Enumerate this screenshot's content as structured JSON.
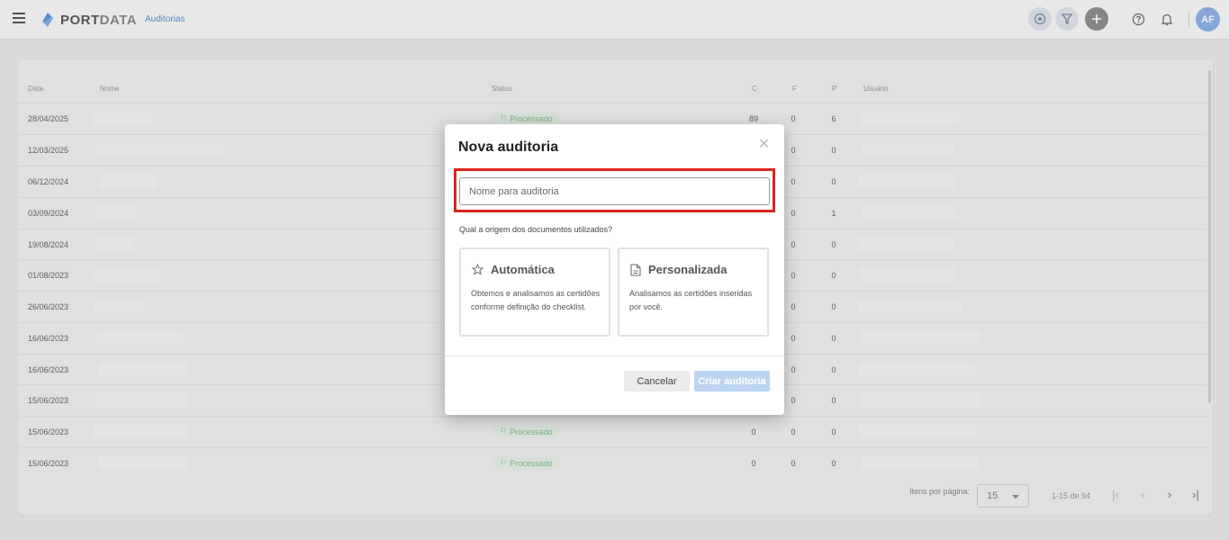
{
  "header": {
    "logo_part1": "PORT",
    "logo_part2": "DATA",
    "breadcrumb": "Auditorias",
    "user_initials": "AF",
    "icons": [
      "menu-icon",
      "target-icon",
      "filter-icon",
      "plus-icon",
      "help-icon",
      "bell-icon"
    ]
  },
  "table": {
    "columns": {
      "date": "Data",
      "name": "Nome",
      "status": "Status",
      "c": "C",
      "f": "F",
      "p": "P",
      "user": "Usuário"
    },
    "rows": [
      {
        "date": "28/04/2025",
        "status": "Processado",
        "c": "89",
        "f": "0",
        "p": "6"
      },
      {
        "date": "12/03/2025",
        "status": "",
        "c": "",
        "f": "0",
        "p": "0"
      },
      {
        "date": "06/12/2024",
        "status": "",
        "c": "",
        "f": "0",
        "p": "0"
      },
      {
        "date": "03/09/2024",
        "status": "",
        "c": "",
        "f": "0",
        "p": "1"
      },
      {
        "date": "19/08/2024",
        "status": "",
        "c": "",
        "f": "0",
        "p": "0"
      },
      {
        "date": "01/08/2023",
        "status": "",
        "c": "",
        "f": "0",
        "p": "0"
      },
      {
        "date": "26/06/2023",
        "status": "",
        "c": "",
        "f": "0",
        "p": "0"
      },
      {
        "date": "16/06/2023",
        "status": "",
        "c": "",
        "f": "0",
        "p": "0"
      },
      {
        "date": "16/06/2023",
        "status": "",
        "c": "",
        "f": "0",
        "p": "0"
      },
      {
        "date": "15/06/2023",
        "status": "",
        "c": "",
        "f": "0",
        "p": "0"
      },
      {
        "date": "15/06/2023",
        "status": "Processado",
        "c": "0",
        "f": "0",
        "p": "0"
      },
      {
        "date": "15/06/2023",
        "status": "Processado",
        "c": "0",
        "f": "0",
        "p": "0"
      }
    ]
  },
  "pagination": {
    "items_per_page_label": "Itens por página:",
    "items_per_page_value": "15",
    "range": "1-15 de 94"
  },
  "modal": {
    "title": "Nova auditoria",
    "name_placeholder": "Nome para auditoria",
    "question": "Qual a origem dos documentos utilizados?",
    "option_auto_title": "Automática",
    "option_auto_desc": "Obtemos e analisamos as certidões conforme definição do checklist.",
    "option_custom_title": "Personalizada",
    "option_custom_desc": "Analisamos as certidões inseridas por você.",
    "cancel_label": "Cancelar",
    "create_label": "Criar auditoria"
  }
}
